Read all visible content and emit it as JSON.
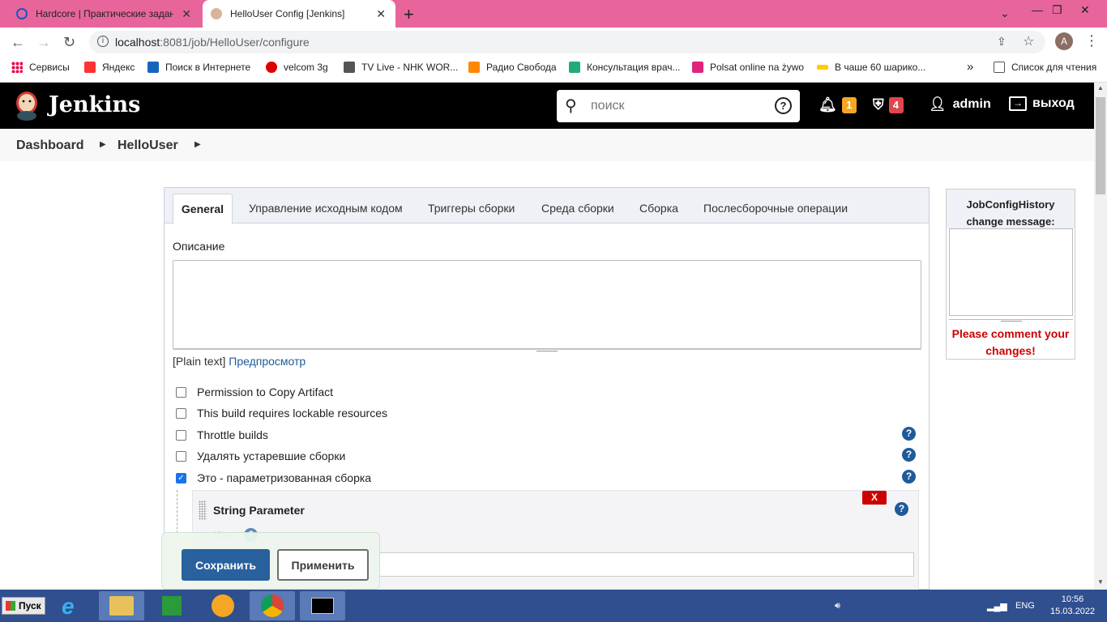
{
  "browser": {
    "tabs": [
      {
        "title": "Hardcore | Практические задани",
        "active": false
      },
      {
        "title": "HelloUser Config [Jenkins]",
        "active": true
      }
    ],
    "new_tab": "+",
    "url_host": "localhost",
    "url_path": ":8081/job/HelloUser/configure",
    "profile_initial": "A",
    "bookmarks": [
      "Сервисы",
      "Яндекс",
      "Поиск в Интернете",
      "velcom 3g",
      "TV Live - NHK WOR...",
      "Радио Свобода",
      "Консультация врач...",
      "Polsat online na żywo",
      "В чаше 60 шарико...",
      "Список для чтения"
    ],
    "bookmarks_more": "»"
  },
  "jenkins": {
    "brand": "Jenkins",
    "search_placeholder": "поиск",
    "notifications_count": "1",
    "security_count": "4",
    "user": "admin",
    "logout": "выход"
  },
  "breadcrumb": [
    "Dashboard",
    "HelloUser"
  ],
  "config": {
    "tabs": [
      "General",
      "Управление исходным кодом",
      "Триггеры сборки",
      "Среда сборки",
      "Сборка",
      "Послесборочные операции"
    ],
    "active_tab": "General",
    "description_label": "Описание",
    "plain_text": "[Plain text]",
    "preview": "Предпросмотр",
    "options": [
      {
        "label": "Permission to Copy Artifact",
        "checked": false,
        "help": false
      },
      {
        "label": "This build requires lockable resources",
        "checked": false,
        "help": false
      },
      {
        "label": "Throttle builds",
        "checked": false,
        "help": true
      },
      {
        "label": "Удалять устаревшие сборки",
        "checked": false,
        "help": true
      },
      {
        "label": "Это - параметризованная сборка",
        "checked": true,
        "help": true
      }
    ],
    "parameter": {
      "title": "String Parameter",
      "delete": "X",
      "name_label": "Имя"
    },
    "save": "Сохранить",
    "apply": "Применить"
  },
  "sidebox": {
    "title": "JobConfigHistory change message:",
    "warning": "Please comment your changes!"
  },
  "taskbar": {
    "start": "Пуск",
    "lang": "ENG",
    "time": "10:56",
    "date": "15.03.2022"
  },
  "colors": {
    "tabstrip": "#e8659b",
    "jenkins_header": "#000000",
    "primary_button": "#1f5a9a",
    "notification_badge": "#f5a623",
    "security_badge": "#e0474c",
    "warning_text": "#cc0000"
  }
}
